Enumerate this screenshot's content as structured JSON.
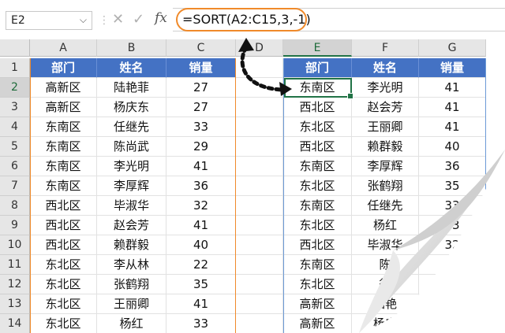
{
  "formula_bar": {
    "name_box": "E2",
    "formula": "=SORT(A2:C15,3,-1)",
    "fx_label": "fx",
    "icons": [
      "chevron-down-icon",
      "cancel-icon",
      "check-icon",
      "fx-icon"
    ]
  },
  "columns": [
    "A",
    "B",
    "C",
    "D",
    "E",
    "F",
    "G"
  ],
  "rows": [
    "1",
    "2",
    "3",
    "4",
    "5",
    "6",
    "7",
    "8",
    "9",
    "10",
    "11",
    "12",
    "13",
    "14"
  ],
  "cells": [
    [
      "部门",
      "姓名",
      "销量",
      "",
      "部门",
      "姓名",
      "销量"
    ],
    [
      "高新区",
      "陆艳菲",
      "27",
      "",
      "东南区",
      "李光明",
      "41"
    ],
    [
      "高新区",
      "杨庆东",
      "27",
      "",
      "西北区",
      "赵会芳",
      "41"
    ],
    [
      "东南区",
      "任继先",
      "33",
      "",
      "东北区",
      "王丽卿",
      "41"
    ],
    [
      "东南区",
      "陈尚武",
      "29",
      "",
      "西北区",
      "赖群毅",
      "40"
    ],
    [
      "东南区",
      "李光明",
      "41",
      "",
      "东南区",
      "李厚辉",
      "36"
    ],
    [
      "东南区",
      "李厚辉",
      "36",
      "",
      "东北区",
      "张鹤翔",
      "35"
    ],
    [
      "西北区",
      "毕淑华",
      "32",
      "",
      "东南区",
      "任继先",
      "33"
    ],
    [
      "西北区",
      "赵会芳",
      "41",
      "",
      "东北区",
      "杨红",
      "33"
    ],
    [
      "西北区",
      "赖群毅",
      "40",
      "",
      "西北区",
      "毕淑华",
      "32"
    ],
    [
      "东北区",
      "李从林",
      "22",
      "",
      "东南区",
      "陈",
      ""
    ],
    [
      "东北区",
      "张鹤翔",
      "35",
      "",
      "东北区",
      "徐",
      ""
    ],
    [
      "东北区",
      "王丽卿",
      "41",
      "",
      "高新区",
      "陆艳",
      ""
    ],
    [
      "东北区",
      "杨红",
      "33",
      "",
      "高新区",
      "杨庆",
      ""
    ]
  ],
  "active_cell": "E2",
  "colors": {
    "header_fill": "#4472c4",
    "header_text": "#ffffff",
    "accent_orange": "#f08a2a",
    "select_green": "#217346"
  }
}
